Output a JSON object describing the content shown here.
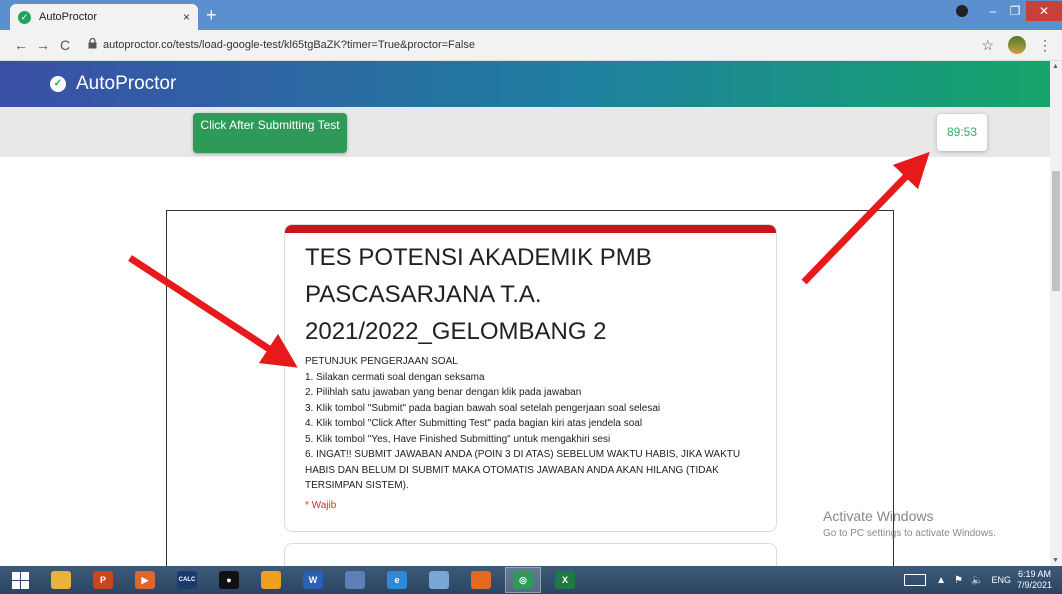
{
  "browser": {
    "tab_title": "AutoProctor",
    "tab_close": "×",
    "new_tab": "+",
    "url": "autoproctor.co/tests/load-google-test/kl65tgBaZK?timer=True&proctor=False",
    "back": "←",
    "forward": "→",
    "reload": "C",
    "lock_icon": "lock-icon",
    "star": "☆",
    "kebab": "⋮",
    "win_min": "–",
    "win_max": "❐",
    "win_close": "✕"
  },
  "header": {
    "title": "AutoProctor",
    "gradient": [
      "#3a4fa6",
      "#1f7fa0",
      "#15a56a"
    ]
  },
  "toolbar": {
    "submit_label": "Click After Submitting Test",
    "timer": "89:53",
    "button_color": "#2f9a58"
  },
  "form": {
    "title": "TES POTENSI AKADEMIK PMB PASCASARJANA T.A. 2021/2022_GELOMBANG 2",
    "accent_color": "#c8151b",
    "instructions": [
      "PETUNJUK PENGERJAAN SOAL",
      "1. Silakan cermati soal dengan seksama",
      "2. Pilihlah satu jawaban yang benar dengan klik pada jawaban",
      "3. Klik tombol \"Submit\" pada bagian bawah soal setelah pengerjaan soal selesai",
      "4. Klik tombol \"Click After Submitting Test\" pada bagian kiri atas jendela soal",
      "5. Klik tombol \"Yes, Have Finished Submitting\" untuk mengakhiri sesi",
      "6. INGAT!! SUBMIT JAWABAN ANDA (POIN 3 DI ATAS) SEBELUM WAKTU HABIS, JIKA WAKTU HABIS DAN BELUM DI SUBMIT MAKA OTOMATIS JAWABAN ANDA AKAN HILANG (TIDAK TERSIMPAN SISTEM)."
    ],
    "required_note": "* Wajib"
  },
  "watermark": {
    "line1": "Activate Windows",
    "line2": "Go to PC settings to activate Windows."
  },
  "taskbar": {
    "apps": [
      {
        "name": "file-explorer-icon",
        "color": "#e8b33c",
        "label": ""
      },
      {
        "name": "powerpoint-icon",
        "color": "#c8461c",
        "label": "P"
      },
      {
        "name": "media-player-icon",
        "color": "#e0652a",
        "label": "▶"
      },
      {
        "name": "calculator-app-icon",
        "color": "#1b3a6e",
        "label": "CALC"
      },
      {
        "name": "record-icon",
        "color": "#111111",
        "label": "●"
      },
      {
        "name": "game-icon",
        "color": "#f0a020",
        "label": ""
      },
      {
        "name": "word-icon",
        "color": "#2b5fb4",
        "label": "W"
      },
      {
        "name": "photos-icon",
        "color": "#5c7fb8",
        "label": ""
      },
      {
        "name": "internet-explorer-icon",
        "color": "#2c8ad8",
        "label": "e"
      },
      {
        "name": "notepad-icon",
        "color": "#7aa6d6",
        "label": ""
      },
      {
        "name": "firefox-icon",
        "color": "#e66a1e",
        "label": ""
      },
      {
        "name": "chrome-icon",
        "color": "#2f9a58",
        "label": "◎"
      },
      {
        "name": "excel-icon",
        "color": "#1d7a43",
        "label": "X"
      }
    ],
    "active_app": 11,
    "lang": "ENG",
    "time": "6:19 AM",
    "date": "7/9/2021"
  }
}
